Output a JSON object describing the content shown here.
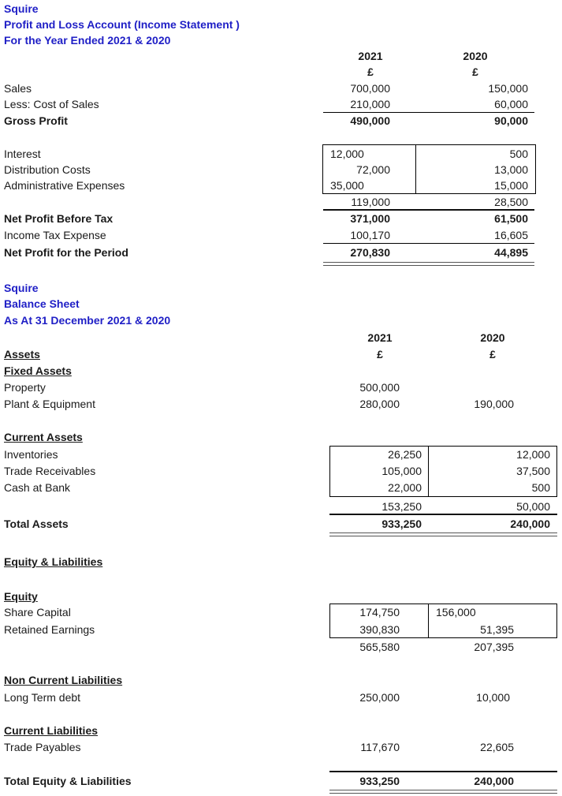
{
  "income_statement": {
    "company": "Squire",
    "title": "Profit and Loss Account (Income Statement )",
    "period": "For the Year Ended 2021 & 2020",
    "headers": {
      "year1": "2021",
      "year2": "2020",
      "currency": "£"
    },
    "rows": {
      "sales": {
        "label": "Sales",
        "y2021": "700,000",
        "y2020": "150,000"
      },
      "cost_of_sales": {
        "label": "Less: Cost of Sales",
        "y2021": "210,000",
        "y2020": "60,000"
      },
      "gross_profit": {
        "label": "Gross Profit",
        "y2021": "490,000",
        "y2020": "90,000"
      },
      "interest": {
        "label": "Interest",
        "y2021": "12,000",
        "y2020": "500"
      },
      "distribution": {
        "label": "Distribution Costs",
        "y2021": "72,000",
        "y2020": "13,000"
      },
      "admin": {
        "label": "Administrative Expenses",
        "y2021": "35,000",
        "y2020": "15,000"
      },
      "expenses_total": {
        "label": "",
        "y2021": "119,000",
        "y2020": "28,500"
      },
      "npbt": {
        "label": "Net Profit Before Tax",
        "y2021": "371,000",
        "y2020": "61,500"
      },
      "tax": {
        "label": "Income Tax Expense",
        "y2021": "100,170",
        "y2020": "16,605"
      },
      "net_profit": {
        "label": "Net Profit for the Period",
        "y2021": "270,830",
        "y2020": "44,895"
      }
    }
  },
  "balance_sheet": {
    "company": "Squire",
    "title": "Balance Sheet",
    "period": "As At 31 December 2021 & 2020",
    "headers": {
      "year1": "2021",
      "year2": "2020",
      "currency": "£"
    },
    "sections": {
      "assets": "Assets",
      "fixed_assets": "Fixed Assets",
      "current_assets": "Current Assets",
      "equity_liabilities": "Equity & Liabilities",
      "equity": "Equity",
      "non_current_liabilities": "Non Current Liabilities",
      "current_liabilities": "Current Liabilities"
    },
    "rows": {
      "property": {
        "label": "Property",
        "y2021": "500,000",
        "y2020": ""
      },
      "plant": {
        "label": "Plant & Equipment",
        "y2021": "280,000",
        "y2020": "190,000"
      },
      "inventories": {
        "label": "Inventories",
        "y2021": "26,250",
        "y2020": "12,000"
      },
      "receivables": {
        "label": "Trade Receivables",
        "y2021": "105,000",
        "y2020": "37,500"
      },
      "cash": {
        "label": "Cash at Bank",
        "y2021": "22,000",
        "y2020": "500"
      },
      "current_total": {
        "label": "",
        "y2021": "153,250",
        "y2020": "50,000"
      },
      "total_assets": {
        "label": "Total Assets",
        "y2021": "933,250",
        "y2020": "240,000"
      },
      "share_capital": {
        "label": "Share Capital",
        "y2021": "174,750",
        "y2020": "156,000"
      },
      "retained": {
        "label": "Retained Earnings",
        "y2021": "390,830",
        "y2020": "51,395"
      },
      "equity_total": {
        "label": "",
        "y2021": "565,580",
        "y2020": "207,395"
      },
      "long_term_debt": {
        "label": "Long Term debt",
        "y2021": "250,000",
        "y2020": "10,000"
      },
      "trade_payables": {
        "label": "Trade Payables",
        "y2021": "117,670",
        "y2020": "22,605"
      },
      "total_eq_liab": {
        "label": "Total Equity & Liabilities",
        "y2021": "933,250",
        "y2020": "240,000"
      }
    }
  }
}
